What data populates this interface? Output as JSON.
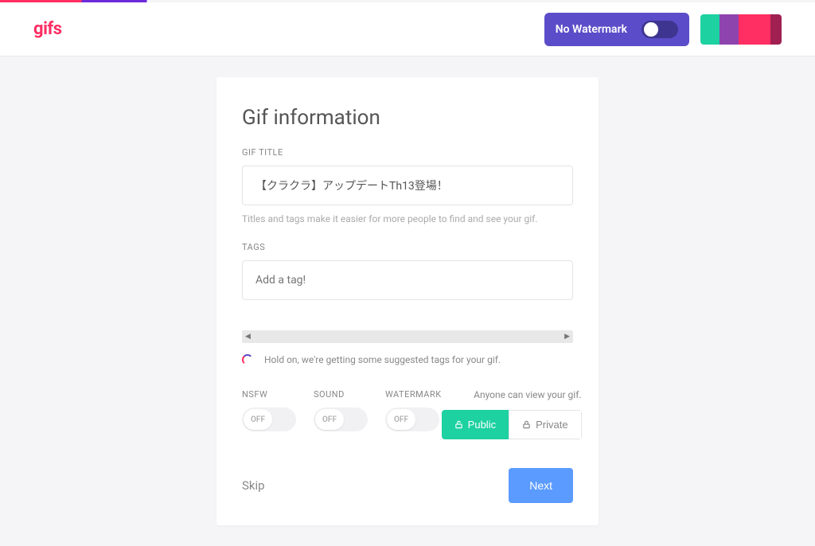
{
  "header": {
    "logo": "gifs",
    "watermark_label": "No Watermark"
  },
  "card": {
    "title": "Gif information",
    "gif_title_label": "GIF TITLE",
    "gif_title_value": "【クラクラ】アップデートTh13登場！",
    "helper_text": "Titles and tags make it easier for more people to find and see your gif.",
    "tags_label": "TAGS",
    "tags_placeholder": "Add a tag!",
    "loading_text": "Hold on, we're getting some suggested tags for your gif."
  },
  "toggles": {
    "nsfw_label": "NSFW",
    "nsfw_value": "OFF",
    "sound_label": "SOUND",
    "sound_value": "OFF",
    "watermark_label": "WATERMARK",
    "watermark_value": "OFF"
  },
  "visibility": {
    "text": "Anyone can view your gif.",
    "public_label": "Public",
    "private_label": "Private"
  },
  "footer": {
    "skip_label": "Skip",
    "next_label": "Next"
  }
}
